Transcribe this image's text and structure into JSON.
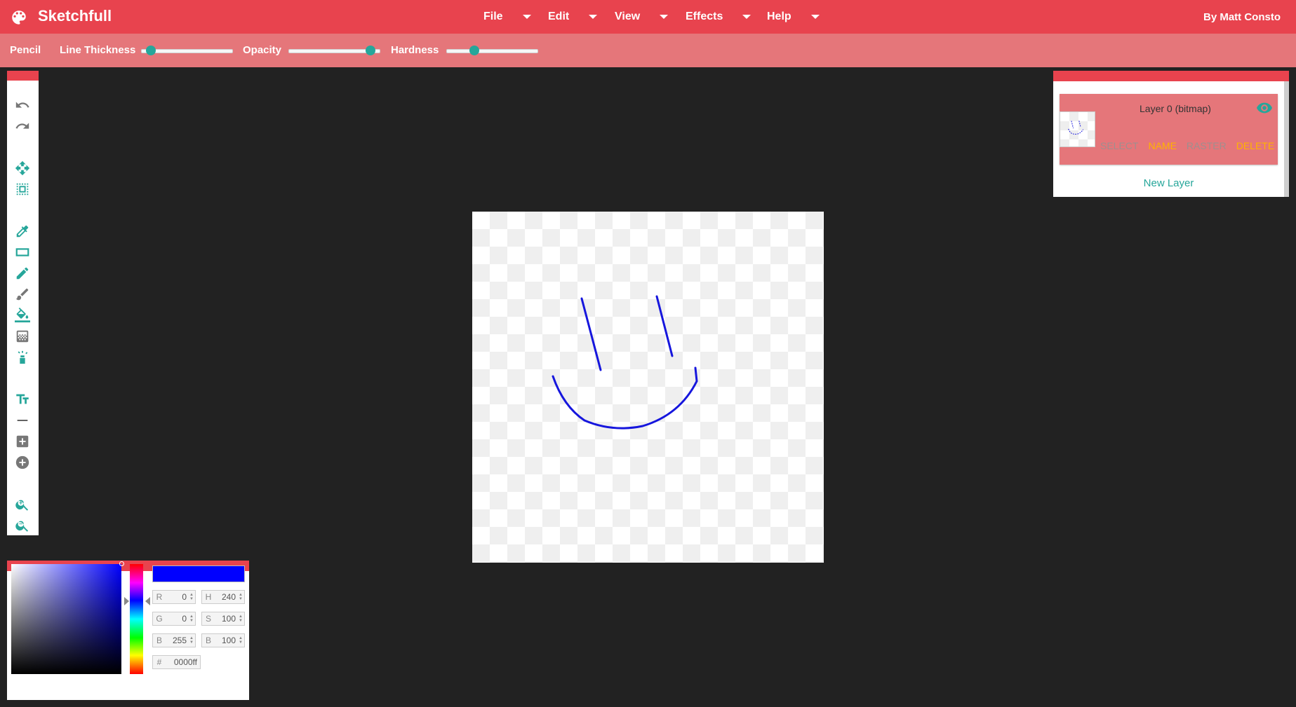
{
  "app": {
    "title": "Sketchfull",
    "author": "By Matt Consto",
    "logo_icon": "palette-icon"
  },
  "menu": [
    {
      "label": "File"
    },
    {
      "label": "Edit"
    },
    {
      "label": "View"
    },
    {
      "label": "Effects"
    },
    {
      "label": "Help"
    }
  ],
  "tool_options": {
    "tool_name": "Pencil",
    "line_thickness": {
      "label": "Line Thickness",
      "value": 0.05
    },
    "opacity": {
      "label": "Opacity",
      "value": 0.95
    },
    "hardness": {
      "label": "Hardness",
      "value": 0.28
    }
  },
  "toolbox": {
    "items": [
      {
        "icon": "undo-icon"
      },
      {
        "icon": "redo-icon"
      },
      {
        "icon": "move-icon"
      },
      {
        "icon": "select-icon"
      },
      {
        "icon": "eyedropper-icon"
      },
      {
        "icon": "rectangle-icon"
      },
      {
        "icon": "pencil-icon"
      },
      {
        "icon": "brush-icon"
      },
      {
        "icon": "fill-bucket-icon"
      },
      {
        "icon": "gradient-icon"
      },
      {
        "icon": "spray-icon"
      },
      {
        "icon": "text-icon"
      },
      {
        "icon": "line-icon"
      },
      {
        "icon": "add-square-icon"
      },
      {
        "icon": "add-circle-icon"
      },
      {
        "icon": "zoom-in-icon"
      },
      {
        "icon": "zoom-out-icon"
      }
    ],
    "accent": "#26a69a"
  },
  "layers": {
    "items": [
      {
        "name": "Layer 0 (bitmap)",
        "actions": {
          "select": "SELECT",
          "name": "NAME",
          "raster": "RASTER",
          "delete": "DELETE"
        }
      }
    ],
    "new_layer_label": "New Layer"
  },
  "color": {
    "hex_value": "0000ff",
    "swatch": "#0000ff",
    "r": {
      "label": "R",
      "value": "0"
    },
    "g": {
      "label": "G",
      "value": "0"
    },
    "b": {
      "label": "B",
      "value": "255"
    },
    "h": {
      "label": "H",
      "value": "240"
    },
    "s": {
      "label": "S",
      "value": "100"
    },
    "br": {
      "label": "B",
      "value": "100"
    },
    "hex": {
      "label": "#",
      "value": "0000ff"
    }
  },
  "colors": {
    "brand": "#e8434e",
    "toolbar": "#e5767a",
    "accent": "#26a69a",
    "stroke": "#1616dd",
    "workspace": "#222222"
  }
}
